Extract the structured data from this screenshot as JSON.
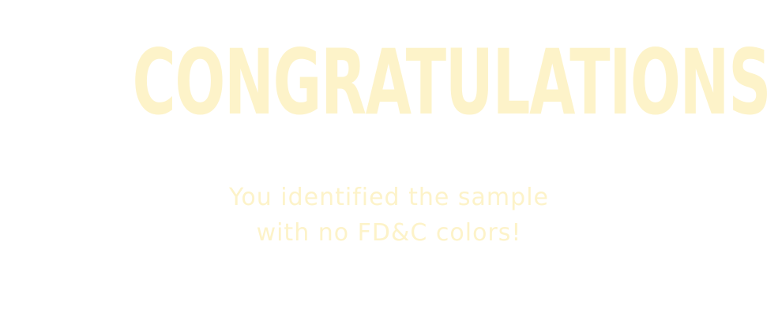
{
  "headline": "CONGRATULATIONS!",
  "message": {
    "line1": "You identified the sample",
    "line2": "with no FD&C colors!"
  },
  "colors": {
    "background": "#ffffff",
    "text": "#fdf3c9"
  }
}
